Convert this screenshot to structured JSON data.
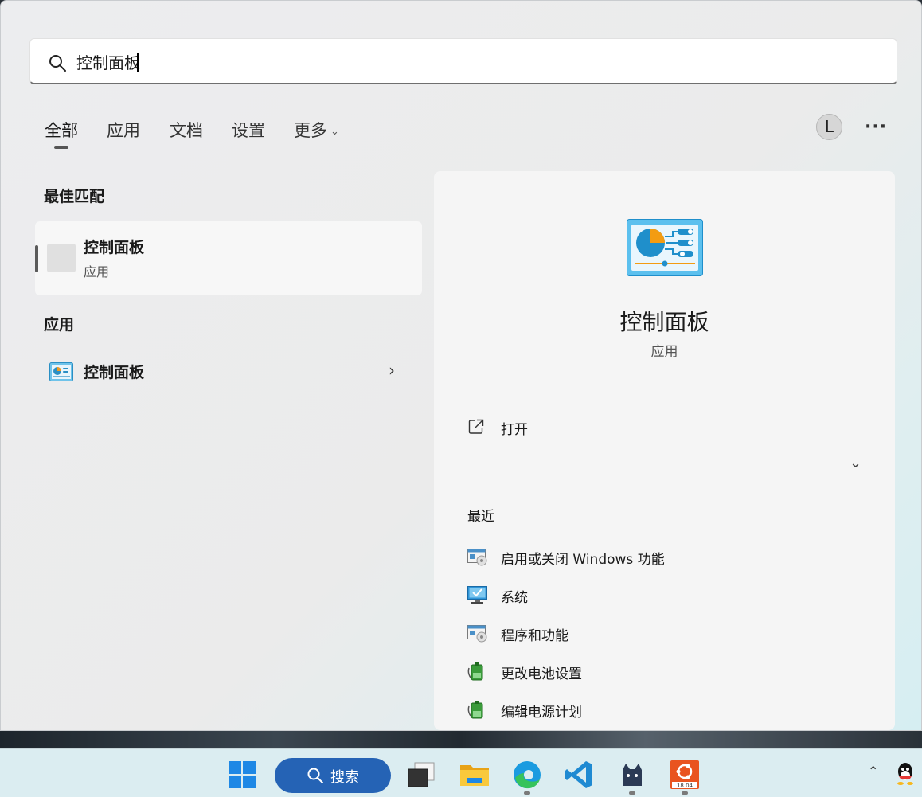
{
  "search": {
    "value": "控制面板",
    "icon": "search-icon"
  },
  "tabs": [
    {
      "label": "全部",
      "active": true
    },
    {
      "label": "应用"
    },
    {
      "label": "文档"
    },
    {
      "label": "设置"
    },
    {
      "label": "更多"
    }
  ],
  "user": {
    "initial": "L"
  },
  "more_options": "···",
  "best_match": {
    "heading": "最佳匹配",
    "name": "控制面板",
    "type": "应用"
  },
  "apps": {
    "heading": "应用",
    "items": [
      {
        "name": "控制面板",
        "icon": "control-panel-icon"
      }
    ]
  },
  "detail": {
    "title": "控制面板",
    "subtitle": "应用",
    "open_label": "打开",
    "recent_heading": "最近",
    "recent": [
      {
        "label": "启用或关闭 Windows 功能",
        "icon": "programs-icon"
      },
      {
        "label": "系统",
        "icon": "system-monitor-icon"
      },
      {
        "label": "程序和功能",
        "icon": "programs-icon"
      },
      {
        "label": "更改电池设置",
        "icon": "power-battery-icon"
      },
      {
        "label": "编辑电源计划",
        "icon": "power-battery-icon"
      }
    ]
  },
  "taskbar": {
    "search_label": "搜索",
    "ubuntu_badge": "18.04"
  },
  "colors": {
    "accent": "#2563b5",
    "panel_bg": "#ebebeb",
    "taskbar_bg": "#dbedf1"
  }
}
